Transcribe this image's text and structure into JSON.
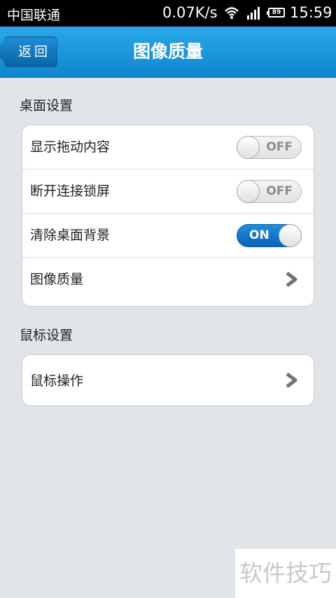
{
  "status_bar": {
    "carrier": "中国联通",
    "speed": "0.07K/s",
    "battery": "89",
    "time": "15:59",
    "icons": [
      "wifi-icon",
      "signal-icon",
      "battery-icon"
    ]
  },
  "header": {
    "back_label": "返回",
    "title": "图像质量"
  },
  "sections": [
    {
      "title": "桌面设置",
      "rows": [
        {
          "label": "显示拖动内容",
          "toggle": "OFF"
        },
        {
          "label": "断开连接锁屏",
          "toggle": "OFF"
        },
        {
          "label": "清除桌面背景",
          "toggle": "ON"
        },
        {
          "label": "图像质量",
          "chevron": true
        }
      ]
    },
    {
      "title": "鼠标设置",
      "rows": [
        {
          "label": "鼠标操作",
          "chevron": true
        }
      ]
    }
  ],
  "watermark": "软件技巧",
  "colors": {
    "accent": "#1a93de",
    "toggle_on": "#1478cc",
    "background": "#e1e4e8"
  }
}
